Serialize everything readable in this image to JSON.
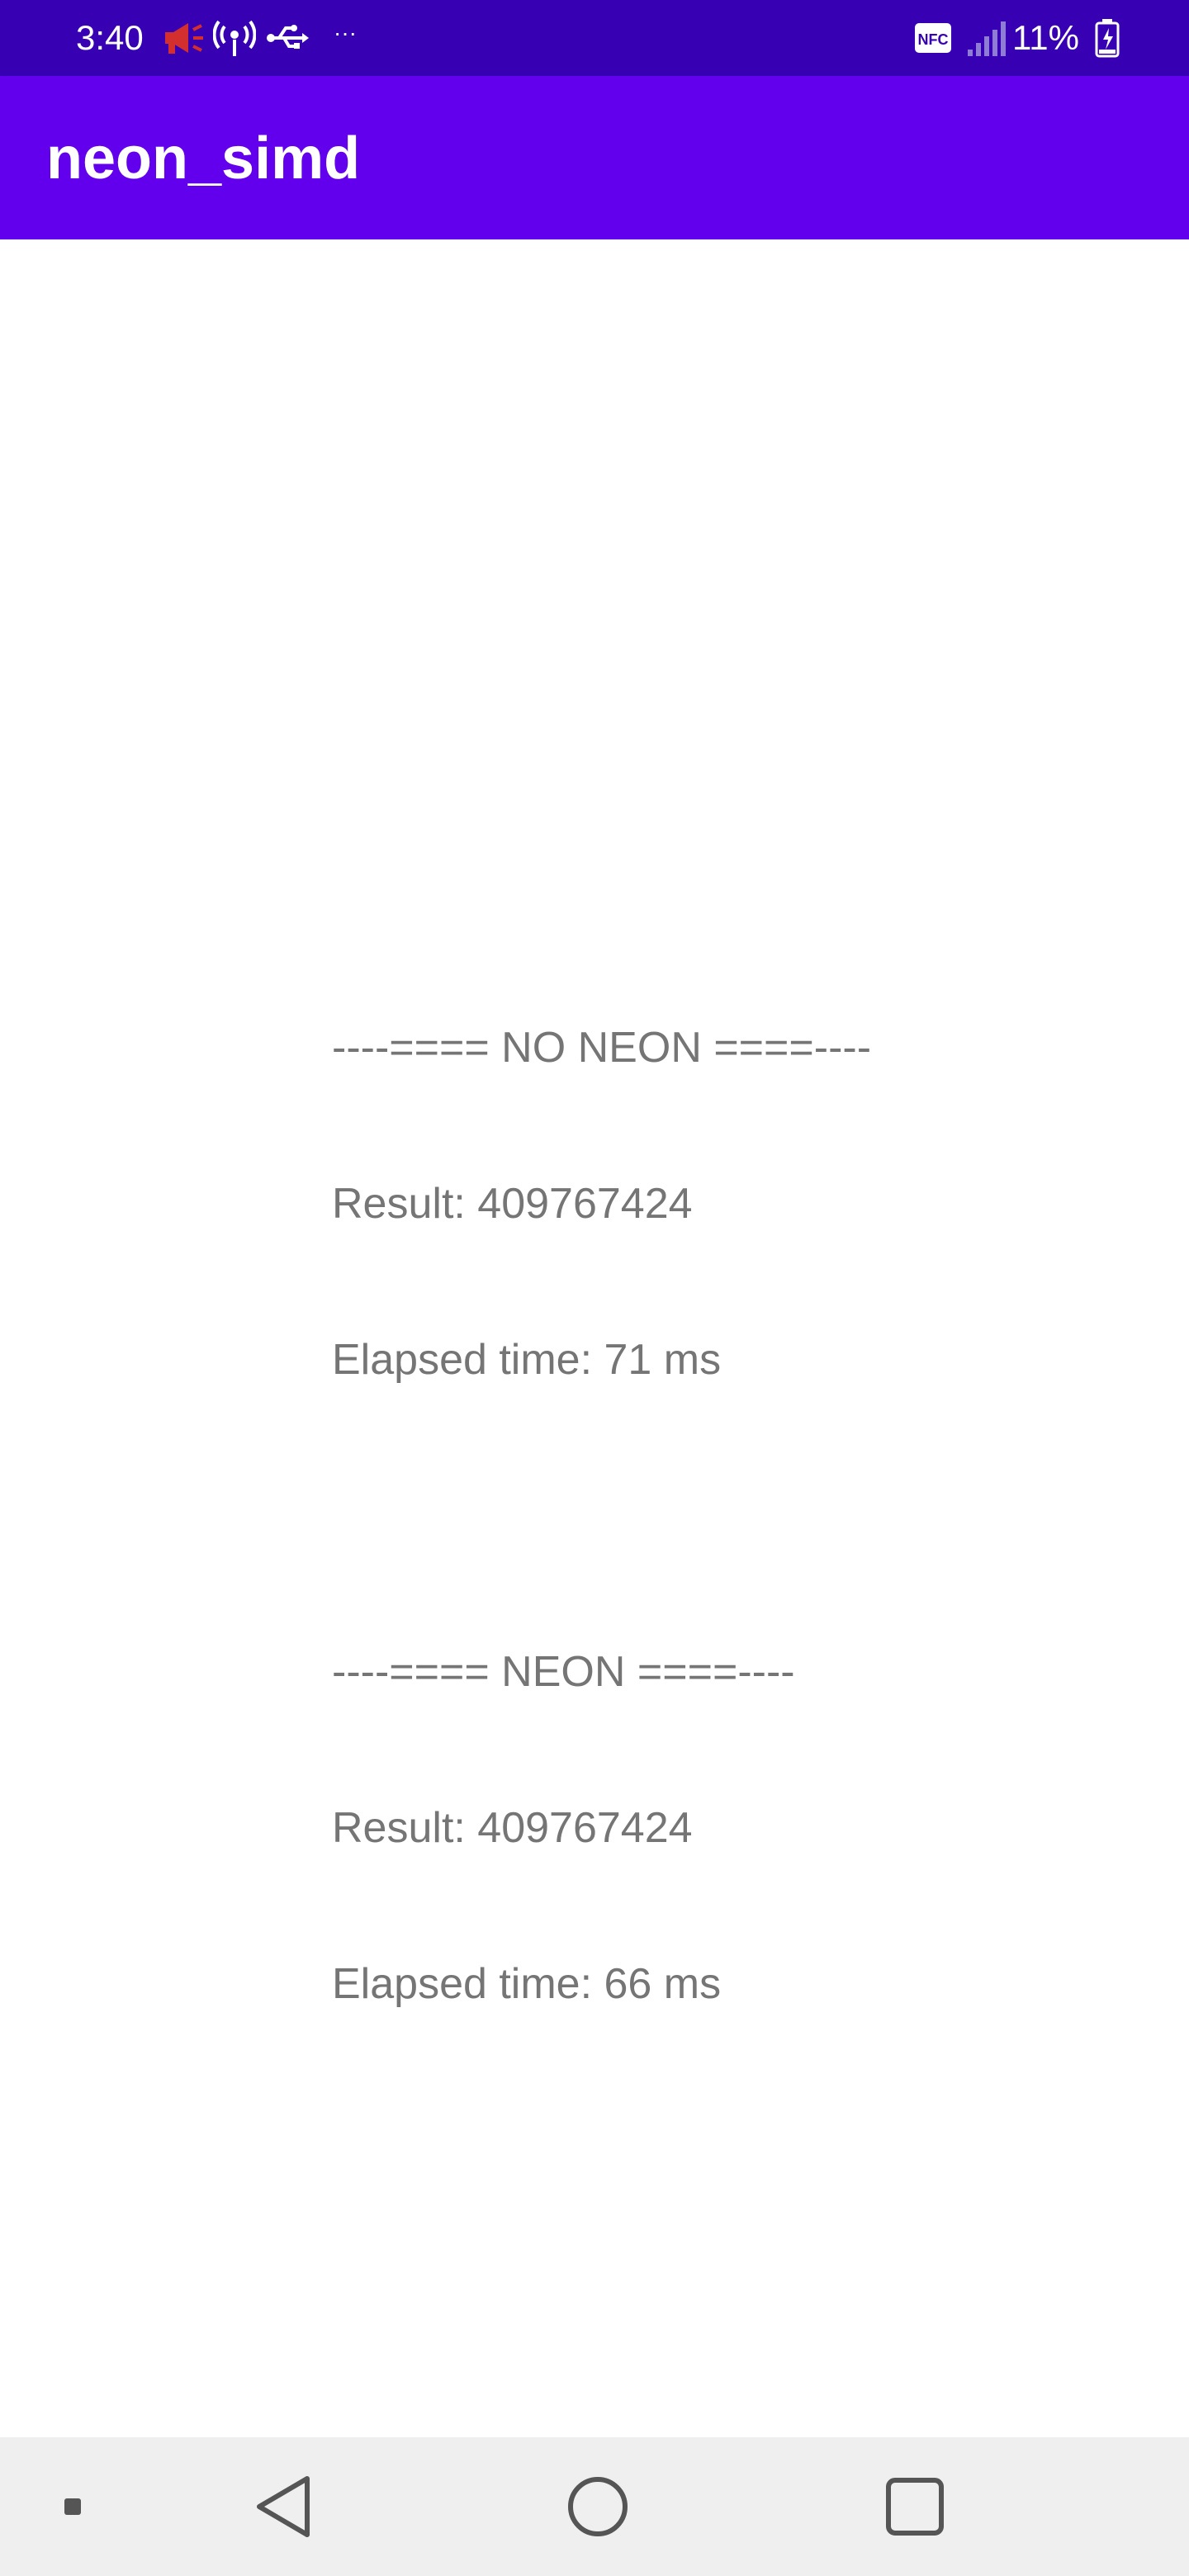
{
  "status_bar": {
    "time": "3:40",
    "battery_percent": "11%",
    "nfc_label": "NFC",
    "overflow_indicator": "···",
    "icons": [
      "megaphone-icon",
      "wifi-hotspot-icon",
      "usb-icon",
      "nfc-icon",
      "signal-icon",
      "battery-charging-icon"
    ],
    "colors": {
      "background": "#3700b3",
      "megaphone": "#d32f2f"
    }
  },
  "app_bar": {
    "title": "neon_simd",
    "color": "#6200ee"
  },
  "results": {
    "no_neon": {
      "header": "----==== NO NEON ====----",
      "result": "Result: 409767424",
      "elapsed": "Elapsed time: 71 ms"
    },
    "neon": {
      "header": "----==== NEON ====----",
      "result": "Result: 409767424",
      "elapsed": "Elapsed time: 66 ms"
    },
    "text_color": "#757575"
  },
  "nav_bar": {
    "buttons": [
      "recents-dot-icon",
      "back-icon",
      "home-icon",
      "overview-icon"
    ]
  }
}
